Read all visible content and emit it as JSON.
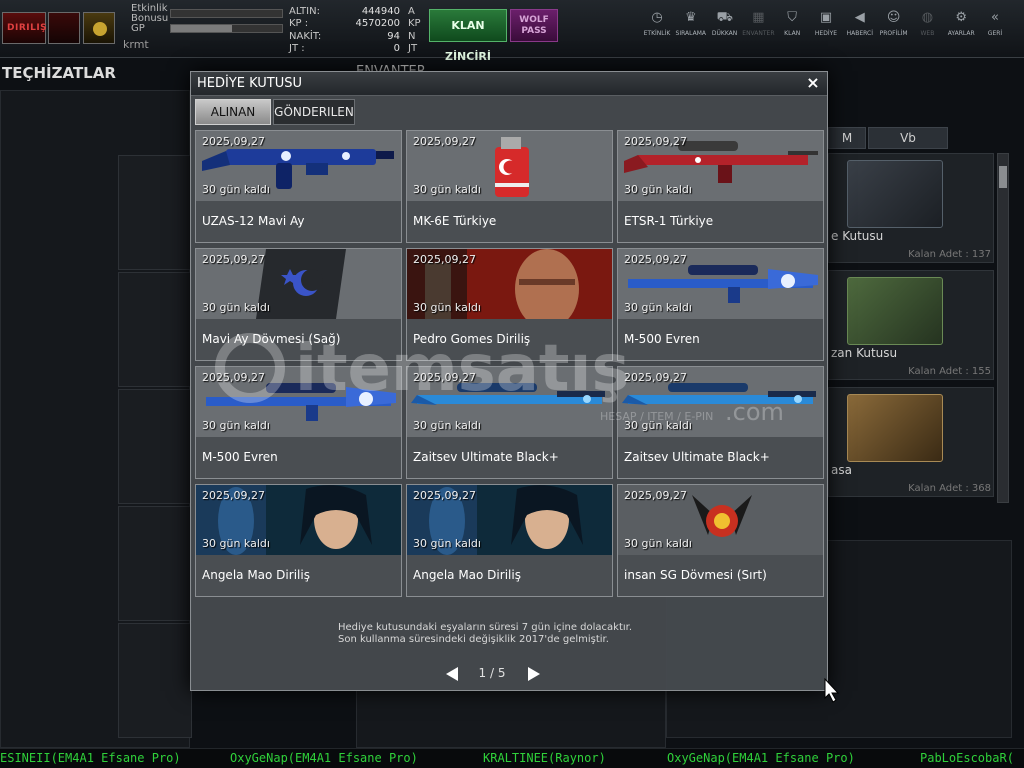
{
  "topbar": {
    "logo_text": "DIRILIŞ",
    "stats": {
      "etkinlik_label": "Etkinlik\nBonusu",
      "gp_label": "GP",
      "etkinlik_level": 0,
      "gp_level": 55
    },
    "player_name": "krmt",
    "currencies": [
      {
        "label": "ALTIN:",
        "value": "444940",
        "unit": "A"
      },
      {
        "label": "KP :",
        "value": "4570200",
        "unit": "KP"
      },
      {
        "label": "NAKİT:",
        "value": "94",
        "unit": "N"
      },
      {
        "label": "JT :",
        "value": "0",
        "unit": "JT"
      }
    ],
    "klan_button": "KLAN ZİNCİRİ",
    "wolf_button": "WOLF\nPASS",
    "nav": [
      {
        "label": "ETKİNLİK",
        "icon": "clock-icon"
      },
      {
        "label": "SIRALAMA",
        "icon": "ranking-icon"
      },
      {
        "label": "DÜKKAN",
        "icon": "cart-icon"
      },
      {
        "label": "ENVANTER",
        "icon": "inventory-icon"
      },
      {
        "label": "KLAN",
        "icon": "shield-icon"
      },
      {
        "label": "HEDİYE",
        "icon": "gift-icon"
      },
      {
        "label": "HABERCİ",
        "icon": "megaphone-icon"
      },
      {
        "label": "PROFİLİM",
        "icon": "profile-icon"
      },
      {
        "label": "WEB",
        "icon": "globe-icon"
      },
      {
        "label": "AYARLAR",
        "icon": "gear-icon"
      },
      {
        "label": "GERİ",
        "icon": "back-icon"
      }
    ]
  },
  "background": {
    "left_title": "TEÇHİZATLAR",
    "center_title": "ENVANTER",
    "tabs": [
      "M",
      "Vb"
    ],
    "boxes": [
      {
        "name": "e Kutusu",
        "count": "Kalan Adet : 137"
      },
      {
        "name": "zan Kutusu",
        "count": "Kalan Adet : 155"
      },
      {
        "name": "asa",
        "count": "Kalan Adet : 368"
      }
    ],
    "ticker": [
      "ESINEII(EM4A1 Efsane Pro)",
      "OxyGeNap(EM4A1 Efsane Pro)",
      "KRALTINEE(Raynor)",
      "OxyGeNap(EM4A1 Efsane Pro)",
      "PabLoEscobaR("
    ]
  },
  "modal": {
    "title": "HEDİYE KUTUSU",
    "close": "×",
    "tabs": {
      "received": "ALINAN",
      "sent": "GÖNDERILEN"
    },
    "items": [
      {
        "date": "2025,09,27",
        "days": "30 gün kaldı",
        "name": "UZAS-12 Mavi Ay",
        "kind": "shotgun"
      },
      {
        "date": "2025,09,27",
        "days": "30 gün kaldı",
        "name": "MK-6E Türkiye",
        "kind": "grenade"
      },
      {
        "date": "2025,09,27",
        "days": "30 gün kaldı",
        "name": "ETSR-1 Türkiye",
        "kind": "sniper-red"
      },
      {
        "date": "2025,09,27",
        "days": "30 gün kaldı",
        "name": "Mavi Ay Dövmesi (Sağ)",
        "kind": "tattoo"
      },
      {
        "date": "2025,09,27",
        "days": "30 gün kaldı",
        "name": "Pedro Gomes Diriliş",
        "kind": "pedro"
      },
      {
        "date": "2025,09,27",
        "days": "30 gün kaldı",
        "name": "M-500 Evren",
        "kind": "sniper-blue"
      },
      {
        "date": "2025,09,27",
        "days": "30 gün kaldı",
        "name": "M-500 Evren",
        "kind": "sniper-blue"
      },
      {
        "date": "2025,09,27",
        "days": "30 gün kaldı",
        "name": "Zaitsev Ultimate Black+",
        "kind": "rifle-blue"
      },
      {
        "date": "2025,09,27",
        "days": "30 gün kaldı",
        "name": "Zaitsev Ultimate Black+",
        "kind": "rifle-blue"
      },
      {
        "date": "2025,09,27",
        "days": "30 gün kaldı",
        "name": "Angela Mao Diriliş",
        "kind": "angela"
      },
      {
        "date": "2025,09,27",
        "days": "30 gün kaldı",
        "name": "Angela Mao Diriliş",
        "kind": "angela"
      },
      {
        "date": "2025,09,27",
        "days": "30 gün kaldı",
        "name": "insan SG Dövmesi (Sırt)",
        "kind": "emblem"
      }
    ],
    "note_lines": [
      "Hediye kutusundaki eşyaların süresi 7 gün içine dolacaktır.",
      "Son kullanma süresindeki değişiklik 2017'de gelmiştir."
    ],
    "pager": "1 / 5"
  },
  "watermark": {
    "text": "itemsatış",
    "sub": "HESAP / ITEM / E-PIN",
    "domain": ".com"
  }
}
